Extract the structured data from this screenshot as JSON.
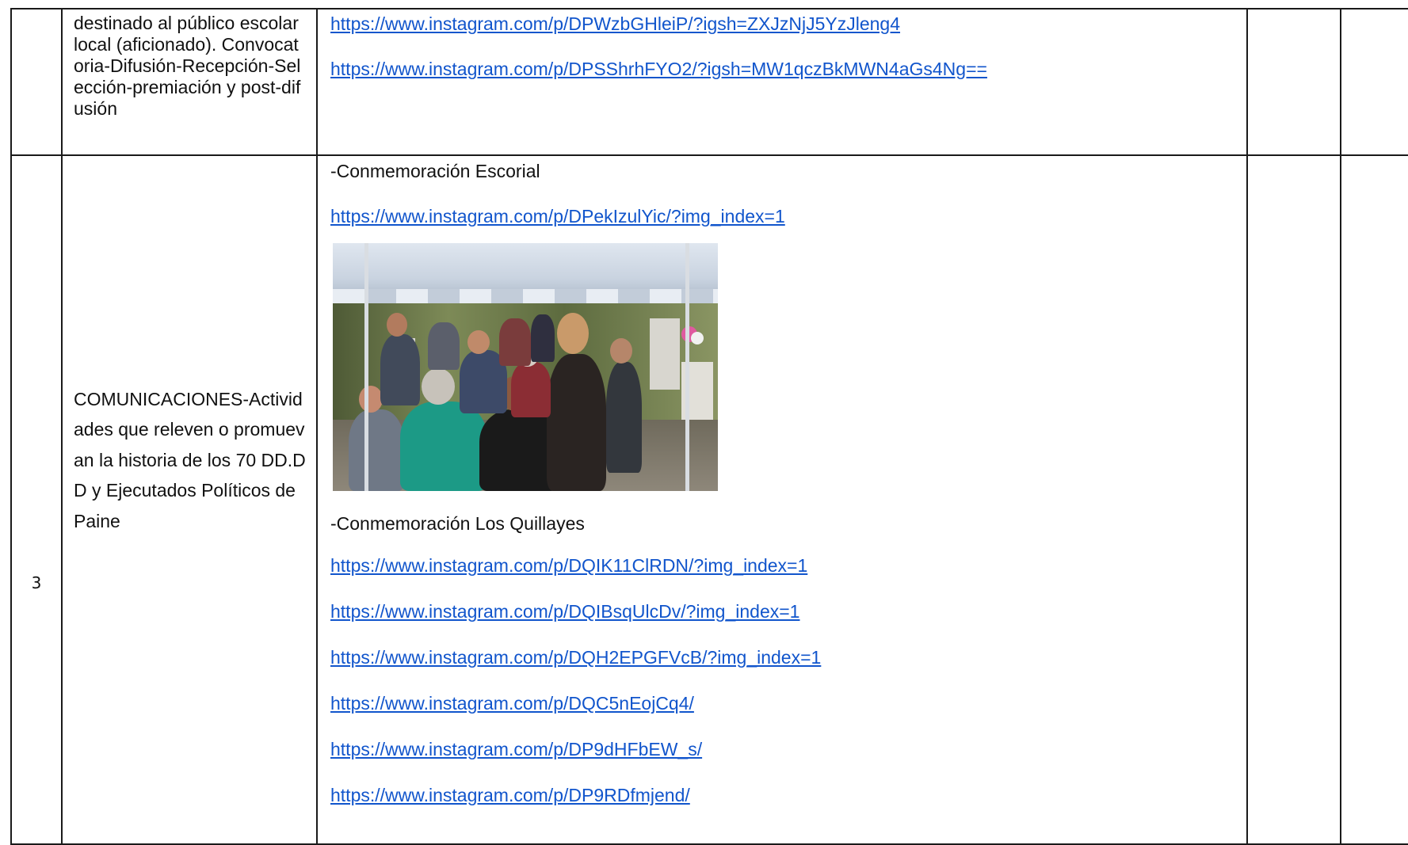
{
  "row_prev": {
    "description": "destinado al público escolar local (aficionado). Convocatoria-Difusión-Recepción-Selección-premiación y post-difusión",
    "links": [
      "https://www.instagram.com/p/DPWzbGHleiP/?igsh=ZXJzNjJ5YzJleng4",
      "https://www.instagram.com/p/DPSShrhFYO2/?igsh=MW1qczBkMWN4aGs4Ng=="
    ]
  },
  "row_3": {
    "number": "3",
    "description": "COMUNICACIONES-Actividades que releven o promuevan la historia de los 70 DD.DD y Ejecutados Políticos de Paine",
    "section_escorial": {
      "heading": "-Conmemoración Escorial",
      "links": [
        "https://www.instagram.com/p/DPekIzulYic/?img_index=1"
      ]
    },
    "section_quillayes": {
      "heading": "-Conmemoración Los Quillayes",
      "links": [
        "https://www.instagram.com/p/DQIK11ClRDN/?img_index=1",
        "https://www.instagram.com/p/DQIBsqUlcDv/?img_index=1",
        "https://www.instagram.com/p/DQH2EPGFVcB/?img_index=1",
        "https://www.instagram.com/p/DQC5nEojCq4/",
        "https://www.instagram.com/p/DP9dHFbEW_s/",
        "https://www.instagram.com/p/DP9RDfmjend/"
      ]
    }
  },
  "colors": {
    "link": "#1155cc",
    "text": "#111111",
    "border": "#1a1a1a"
  }
}
